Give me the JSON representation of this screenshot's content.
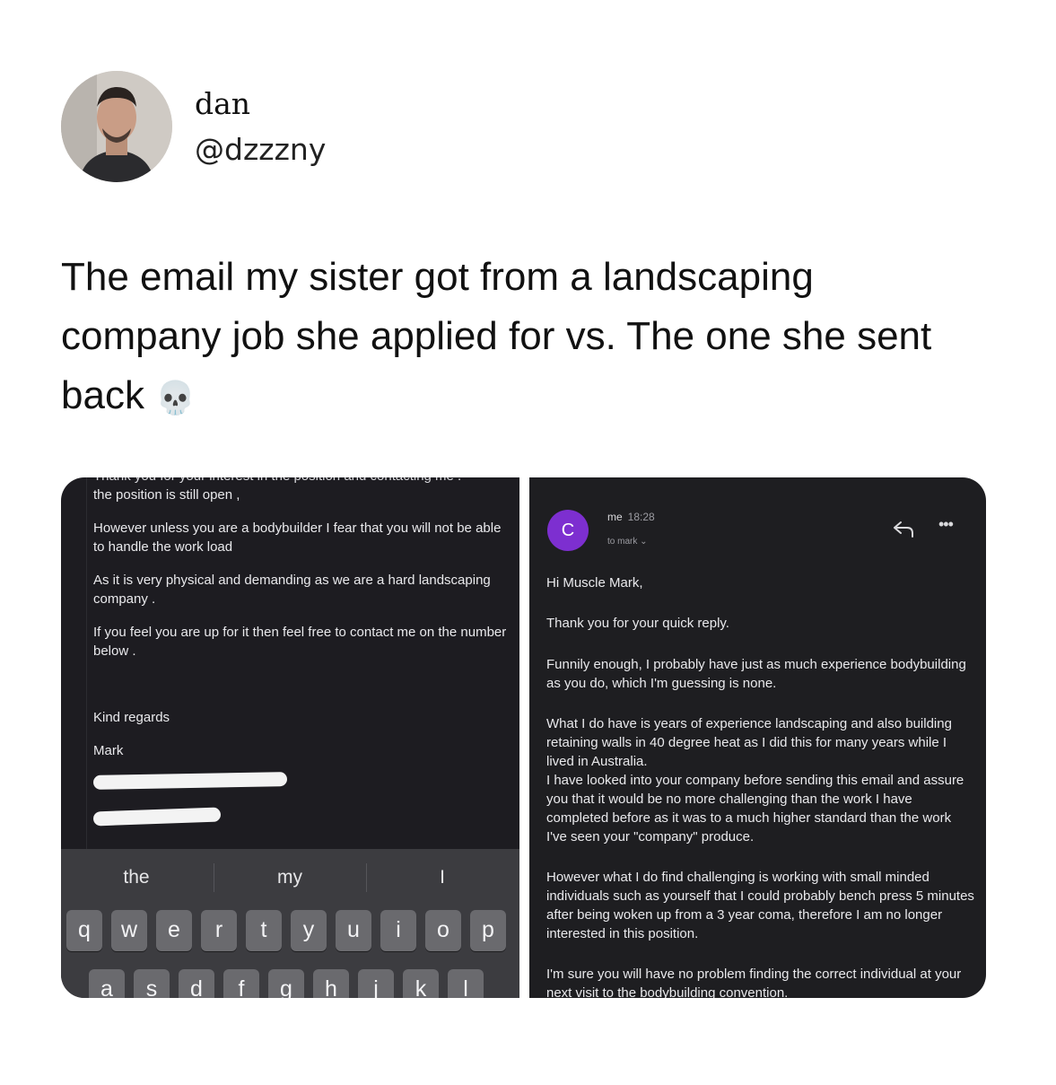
{
  "tweet": {
    "display_name": "dan",
    "handle": "@dzzzny",
    "text": "The email my sister got from a landscaping company job she applied for vs. The one she sent back",
    "emoji": "💀"
  },
  "left_email": {
    "cut_line": "Thank you for your interest in the position and contacting me .",
    "paragraphs": [
      "the position is still open ,",
      "However unless you are a bodybuilder I fear that you will not be able to handle the work load",
      "As it is very physical and demanding as we are a hard landscaping company .",
      "If you feel you are up for it then feel free to contact me on the number below ."
    ],
    "sign_off": "Kind regards",
    "signature": "Mark"
  },
  "keyboard": {
    "suggestions": [
      "the",
      "my",
      "I"
    ],
    "row1": [
      "q",
      "w",
      "e",
      "r",
      "t",
      "y",
      "u",
      "i",
      "o",
      "p"
    ],
    "row2": [
      "a",
      "s",
      "d",
      "f",
      "g",
      "h",
      "j",
      "k",
      "l"
    ]
  },
  "right_email": {
    "avatar_letter": "C",
    "sender": "me",
    "time": "18:28",
    "to": "to mark",
    "more": "•••",
    "greeting": "Hi Muscle Mark,",
    "paragraphs": [
      "Thank you for your quick reply.",
      "Funnily enough, I probably have just as much experience bodybuilding as you do, which I'm guessing is none.",
      "What I do have is years of experience landscaping and also building retaining walls in 40 degree heat as I did this for many years while I lived in Australia.",
      "I have looked into your company before sending this email and assure you that it would be no more challenging than the work I have completed before as it was to a much higher standard than the work I've seen your \"company\" produce.",
      "However what I do find challenging is working with small minded individuals such as yourself that I could probably bench press 5 minutes after being woken up from a 3 year coma, therefore I am no longer interested in this position.",
      "I'm sure you will have no problem finding the correct individual at your next visit to the bodybuilding convention."
    ]
  }
}
